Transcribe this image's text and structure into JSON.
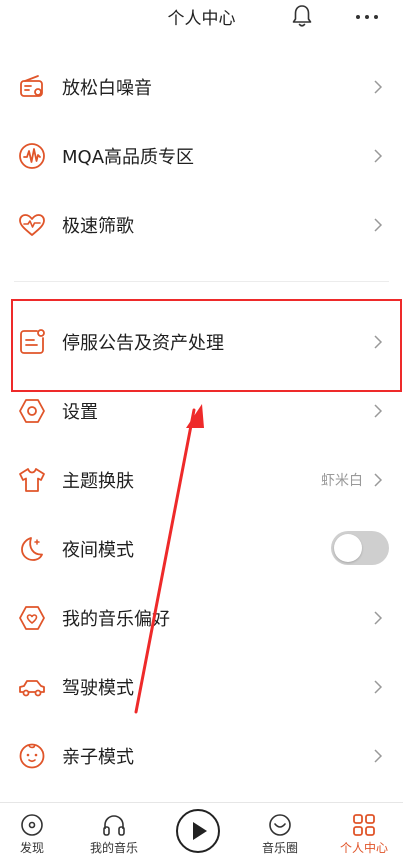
{
  "header": {
    "title": "个人中心",
    "bell_icon": "bell-icon",
    "more_icon": "more-icon"
  },
  "menu": {
    "items": [
      {
        "label": "放松白噪音",
        "icon": "radio-icon"
      },
      {
        "label": "MQA高品质专区",
        "icon": "waveform-icon"
      },
      {
        "label": "极速筛歌",
        "icon": "heart-pulse-icon"
      },
      {
        "label": "停服公告及资产处理",
        "icon": "notice-icon"
      },
      {
        "label": "设置",
        "icon": "settings-icon"
      },
      {
        "label": "主题换肤",
        "icon": "tshirt-icon",
        "value": "虾米白"
      },
      {
        "label": "夜间模式",
        "icon": "moon-icon",
        "toggle_on": false
      },
      {
        "label": "我的音乐偏好",
        "icon": "music-preference-icon"
      },
      {
        "label": "驾驶模式",
        "icon": "car-icon"
      },
      {
        "label": "亲子模式",
        "icon": "baby-face-icon"
      }
    ]
  },
  "tabbar": {
    "tabs": [
      {
        "label": "发现",
        "icon": "disc-icon"
      },
      {
        "label": "我的音乐",
        "icon": "headphones-icon"
      },
      {
        "label": "",
        "icon": "play-icon"
      },
      {
        "label": "音乐圈",
        "icon": "smile-circle-icon"
      },
      {
        "label": "个人中心",
        "icon": "grid-icon",
        "active": true
      }
    ]
  },
  "colors": {
    "accent": "#e0552a",
    "highlight": "#ee2a2a"
  }
}
